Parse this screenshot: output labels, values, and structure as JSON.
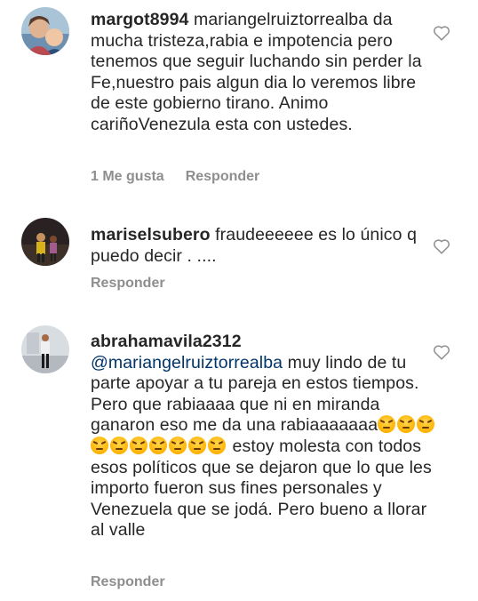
{
  "comments": [
    {
      "username": "margot8994",
      "text": " mariangelruiztorrealba da mucha tristeza,rabia e impotencia pero tenemos que seguir luchando sin perder la Fe,nuestro pais algun dia lo veremos libre de este gobierno tirano. Animo cariñoVenezula esta con ustedes.",
      "likes": "1 Me gusta",
      "reply": "Responder"
    },
    {
      "username": "mariselsubero",
      "text": " fraudeeeeee es lo único q puedo decir . ....",
      "reply": "Responder"
    },
    {
      "username": "abrahamavila2312",
      "mention": "@mariangelruiztorrealba",
      "text_before_emoji": " muy lindo de tu parte apoyar a tu pareja en estos tiempos. Pero que rabiaaaa que ni en miranda ganaron eso me da una rabiaaaaaaa",
      "emoji_count": 10,
      "text_after_emoji": " estoy molesta con todos esos políticos que se dejaron que lo que les importo fueron sus fines personales y Venezuela que se jodá.  Pero bueno a llorar al valle",
      "reply": "Responder"
    }
  ],
  "icons": {
    "like": "heart-outline-icon",
    "emoji": "angry-face-emoji"
  }
}
